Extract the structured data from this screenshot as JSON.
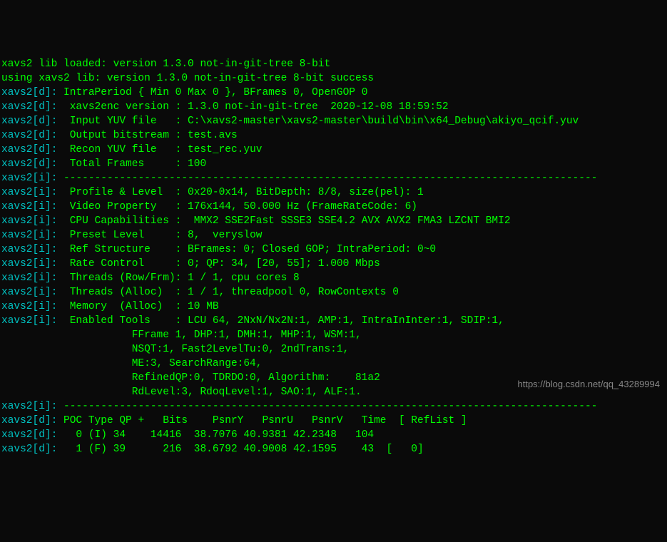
{
  "lines": [
    {
      "prefix": "",
      "text": "xavs2 lib loaded: version 1.3.0 not-in-git-tree 8-bit"
    },
    {
      "prefix": "",
      "text": "using xavs2 lib: version 1.3.0 not-in-git-tree 8-bit success"
    },
    {
      "prefix": "xavs2[d]:",
      "text": " IntraPeriod { Min 0 Max 0 }, BFrames 0, OpenGOP 0"
    },
    {
      "prefix": "xavs2[d]:",
      "text": "  xavs2enc version : 1.3.0 not-in-git-tree  2020-12-08 18:59:52"
    },
    {
      "prefix": "xavs2[d]:",
      "text": "  Input YUV file   : C:\\xavs2-master\\xavs2-master\\build\\bin\\x64_Debug\\akiyo_qcif.yuv"
    },
    {
      "prefix": "xavs2[d]:",
      "text": "  Output bitstream : test.avs"
    },
    {
      "prefix": "xavs2[d]:",
      "text": "  Recon YUV file   : test_rec.yuv"
    },
    {
      "prefix": "xavs2[d]:",
      "text": "  Total Frames     : 100"
    },
    {
      "prefix": "xavs2[i]:",
      "text": " --------------------------------------------------------------------------------------"
    },
    {
      "prefix": "xavs2[i]:",
      "text": "  Profile & Level  : 0x20-0x14, BitDepth: 8/8, size(pel): 1"
    },
    {
      "prefix": "xavs2[i]:",
      "text": "  Video Property   : 176x144, 50.000 Hz (FrameRateCode: 6)"
    },
    {
      "prefix": "xavs2[i]:",
      "text": "  CPU Capabilities :  MMX2 SSE2Fast SSSE3 SSE4.2 AVX AVX2 FMA3 LZCNT BMI2"
    },
    {
      "prefix": "xavs2[i]:",
      "text": "  Preset Level     : 8,  veryslow"
    },
    {
      "prefix": "xavs2[i]:",
      "text": "  Ref Structure    : BFrames: 0; Closed GOP; IntraPeriod: 0~0"
    },
    {
      "prefix": "xavs2[i]:",
      "text": "  Rate Control     : 0; QP: 34, [20, 55]; 1.000 Mbps"
    },
    {
      "prefix": "xavs2[i]:",
      "text": "  Threads (Row/Frm): 1 / 1, cpu cores 8"
    },
    {
      "prefix": "xavs2[i]:",
      "text": "  Threads (Alloc)  : 1 / 1, threadpool 0, RowContexts 0"
    },
    {
      "prefix": "xavs2[i]:",
      "text": "  Memory  (Alloc)  : 10 MB"
    },
    {
      "prefix": "xavs2[i]:",
      "text": "  Enabled Tools    : LCU 64, 2NxN/Nx2N:1, AMP:1, IntraInInter:1, SDIP:1,"
    },
    {
      "prefix": "",
      "text": "                     FFrame 1, DHP:1, DMH:1, MHP:1, WSM:1,"
    },
    {
      "prefix": "",
      "text": "                     NSQT:1, Fast2LevelTu:0, 2ndTrans:1,"
    },
    {
      "prefix": "",
      "text": "                     ME:3, SearchRange:64,"
    },
    {
      "prefix": "",
      "text": "                     RefinedQP:0, TDRDO:0, Algorithm:    81a2"
    },
    {
      "prefix": "",
      "text": "                     RdLevel:3, RdoqLevel:1, SAO:1, ALF:1."
    },
    {
      "prefix": "xavs2[i]:",
      "text": " --------------------------------------------------------------------------------------"
    },
    {
      "prefix": "xavs2[d]:",
      "text": " POC Type QP +   Bits    PsnrY   PsnrU   PsnrV   Time  [ RefList ]"
    },
    {
      "prefix": "xavs2[d]:",
      "text": "   0 (I) 34    14416  38.7076 40.9381 42.2348   104"
    },
    {
      "prefix": "xavs2[d]:",
      "text": "   1 (F) 39      216  38.6792 40.9008 42.1595    43  [   0]"
    }
  ],
  "watermark": "https://blog.csdn.net/qq_43289994"
}
